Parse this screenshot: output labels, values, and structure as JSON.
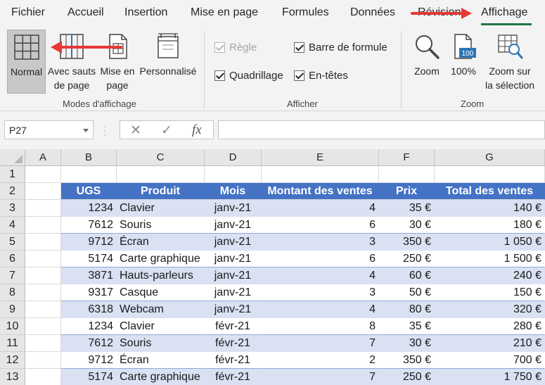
{
  "tabs": [
    {
      "label": "Fichier"
    },
    {
      "label": "Accueil"
    },
    {
      "label": "Insertion"
    },
    {
      "label": "Mise en page"
    },
    {
      "label": "Formules"
    },
    {
      "label": "Données"
    },
    {
      "label": "Révision"
    },
    {
      "label": "Affichage",
      "active": true
    }
  ],
  "ribbon": {
    "views_group": {
      "label": "Modes d'affichage",
      "normal": "Normal",
      "page_break_1": "Avec sauts",
      "page_break_2": "de page",
      "page_layout_1": "Mise en",
      "page_layout_2": "page",
      "custom": "Personnalisé"
    },
    "show_group": {
      "label": "Afficher",
      "ruler": "Règle",
      "formula_bar": "Barre de formule",
      "gridlines": "Quadrillage",
      "headings": "En-têtes"
    },
    "zoom_group": {
      "label": "Zoom",
      "zoom": "Zoom",
      "zoom100": "100%",
      "zoom100_badge": "100",
      "zoom_sel_1": "Zoom sur",
      "zoom_sel_2": "la sélection"
    }
  },
  "formula_bar": {
    "name_box": "P27",
    "cancel": "✕",
    "enter": "✓",
    "fx": "fx",
    "value": ""
  },
  "columns": [
    "A",
    "B",
    "C",
    "D",
    "E",
    "F",
    "G"
  ],
  "rows": [
    "1",
    "2",
    "3",
    "4",
    "5",
    "6",
    "7",
    "8",
    "9",
    "10",
    "11",
    "12",
    "13"
  ],
  "table": {
    "headers": [
      "UGS",
      "Produit",
      "Mois",
      "Montant des ventes",
      "Prix",
      "Total des ventes"
    ],
    "data": [
      [
        "1234",
        "Clavier",
        "janv-21",
        "4",
        "35 €",
        "140 €"
      ],
      [
        "7612",
        "Souris",
        "janv-21",
        "6",
        "30 €",
        "180 €"
      ],
      [
        "9712",
        "Écran",
        "janv-21",
        "3",
        "350 €",
        "1 050 €"
      ],
      [
        "5174",
        "Carte graphique",
        "janv-21",
        "6",
        "250 €",
        "1 500 €"
      ],
      [
        "3871",
        "Hauts-parleurs",
        "janv-21",
        "4",
        "60 €",
        "240 €"
      ],
      [
        "9317",
        "Casque",
        "janv-21",
        "3",
        "50 €",
        "150 €"
      ],
      [
        "6318",
        "Webcam",
        "janv-21",
        "4",
        "80 €",
        "320 €"
      ],
      [
        "1234",
        "Clavier",
        "févr-21",
        "8",
        "35 €",
        "280 €"
      ],
      [
        "7612",
        "Souris",
        "févr-21",
        "7",
        "30 €",
        "210 €"
      ],
      [
        "9712",
        "Écran",
        "févr-21",
        "2",
        "350 €",
        "700 €"
      ],
      [
        "5174",
        "Carte graphique",
        "févr-21",
        "7",
        "250 €",
        "1 750 €"
      ]
    ]
  },
  "colors": {
    "accent": "#217346",
    "table_header": "#4472c4",
    "table_band": "#d9e1f2",
    "annotation_arrow": "#e53935"
  }
}
